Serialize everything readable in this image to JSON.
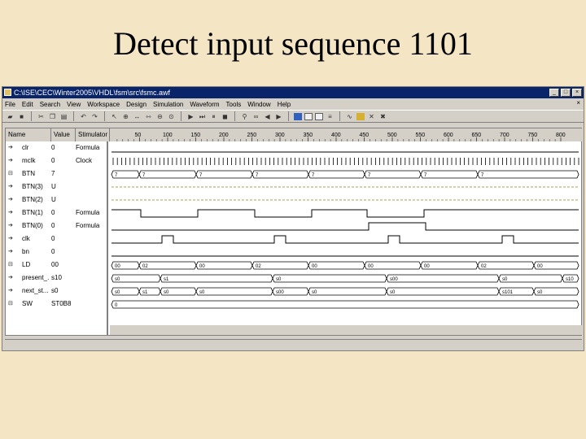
{
  "slide": {
    "title": "Detect input sequence 1101"
  },
  "window": {
    "title": "C:\\ISE\\CEC\\Winter2005\\VHDL\\fsm\\src\\fsmc.awf",
    "minimize": "_",
    "maximize": "□",
    "close": "×"
  },
  "menu": [
    "File",
    "Edit",
    "Search",
    "View",
    "Workspace",
    "Design",
    "Simulation",
    "Waveform",
    "Tools",
    "Window",
    "Help"
  ],
  "header": {
    "name": "Name",
    "value": "Value",
    "stimulator": "Stimulator"
  },
  "ruler": [
    "50",
    "100",
    "150",
    "200",
    "250",
    "300",
    "350",
    "400",
    "450",
    "500",
    "550",
    "600",
    "650",
    "700",
    "750",
    "800"
  ],
  "signals": [
    {
      "name": "clr",
      "value": "0",
      "stim": "Formula",
      "icon": "input-arrow-icon"
    },
    {
      "name": "mclk",
      "value": "0",
      "stim": "Clock",
      "icon": "input-arrow-icon"
    },
    {
      "name": "BTN",
      "value": "7",
      "stim": "",
      "icon": "bus-icon"
    },
    {
      "name": "BTN(3)",
      "value": "U",
      "stim": "",
      "icon": "input-arrow-icon"
    },
    {
      "name": "BTN(2)",
      "value": "U",
      "stim": "",
      "icon": "input-arrow-icon"
    },
    {
      "name": "BTN(1)",
      "value": "0",
      "stim": "Formula",
      "icon": "input-arrow-icon"
    },
    {
      "name": "BTN(0)",
      "value": "0",
      "stim": "Formula",
      "icon": "input-arrow-icon"
    },
    {
      "name": "clk",
      "value": "0",
      "stim": "",
      "icon": "output-arrow-icon"
    },
    {
      "name": "bn",
      "value": "0",
      "stim": "",
      "icon": "output-arrow-icon"
    },
    {
      "name": "LD",
      "value": "00",
      "stim": "",
      "icon": "bus-icon"
    },
    {
      "name": "present_...",
      "value": "s10",
      "stim": "",
      "icon": "output-arrow-icon"
    },
    {
      "name": "next_st...",
      "value": "s0",
      "stim": "",
      "icon": "output-arrow-icon"
    },
    {
      "name": "SW",
      "value": "ST0B8",
      "stim": "",
      "icon": "bus-icon"
    }
  ],
  "bus_labels": {
    "btn": [
      "7",
      "7",
      "7",
      "7",
      "7",
      "7",
      "7",
      "7"
    ],
    "ld": [
      "00",
      "02",
      "00",
      "02",
      "00",
      "00",
      "00",
      "02",
      "00"
    ],
    "present": [
      "s0",
      "s1",
      "s0",
      "s00",
      "s0",
      "s10"
    ],
    "next": [
      "s0",
      "s1",
      "s0",
      "s0",
      "s00",
      "s0",
      "s0",
      "s101",
      "s0"
    ],
    "sw": [
      "0"
    ]
  },
  "colors": {
    "background": "#f4e6c4",
    "titlebar": "#0a246a",
    "chrome": "#d4d0c8",
    "wave": "#000000"
  }
}
